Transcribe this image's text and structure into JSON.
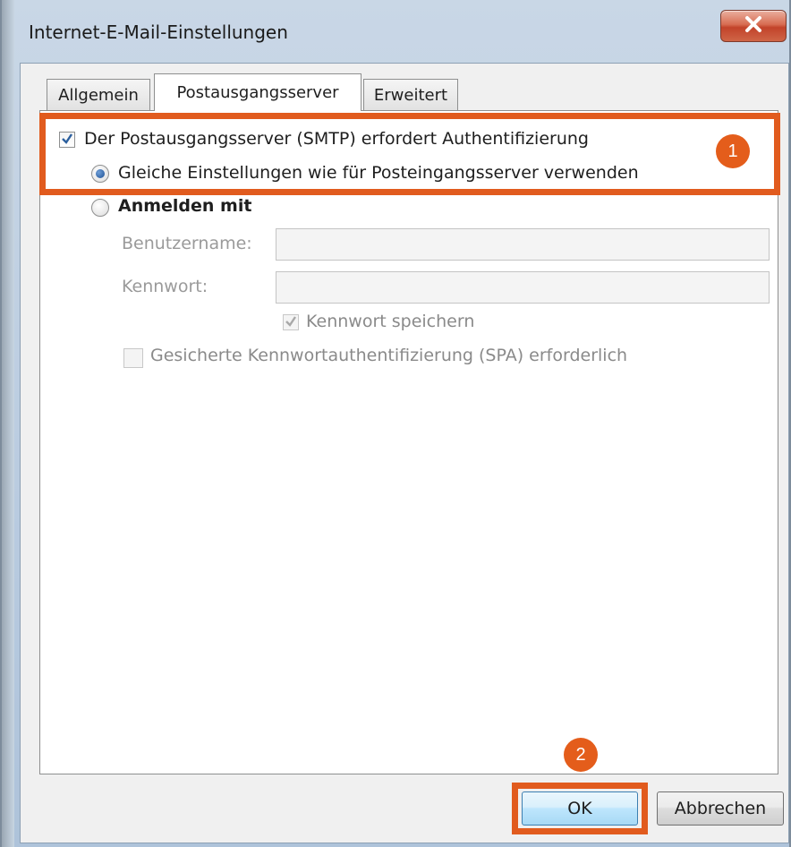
{
  "window": {
    "title": "Internet-E-Mail-Einstellungen",
    "close_symbol": "X"
  },
  "tabs": [
    {
      "label": "Allgemein",
      "active": false
    },
    {
      "label": "Postausgangsserver",
      "active": true
    },
    {
      "label": "Erweitert",
      "active": false
    }
  ],
  "smtp_auth": {
    "checkbox_label": "Der Postausgangsserver (SMTP) erfordert Authentifizierung",
    "checked": true,
    "radio_same_settings_label": "Gleiche Einstellungen wie für Posteingangsserver verwenden",
    "radio_same_settings_selected": true,
    "radio_login_label": "Anmelden mit",
    "radio_login_selected": false
  },
  "login": {
    "username_label": "Benutzername:",
    "username_value": "",
    "password_label": "Kennwort:",
    "password_value": "",
    "save_password_label": "Kennwort speichern",
    "save_password_checked": true,
    "spa_label": "Gesicherte Kennwortauthentifizierung (SPA) erforderlich",
    "spa_checked": false
  },
  "annotations": {
    "badge_1": "1",
    "badge_2": "2",
    "highlight_color": "#e15b1e"
  },
  "buttons": {
    "ok_label": "OK",
    "cancel_label": "Abbrechen"
  },
  "icons": {
    "close": "close-icon",
    "check": "checkmark-icon"
  }
}
